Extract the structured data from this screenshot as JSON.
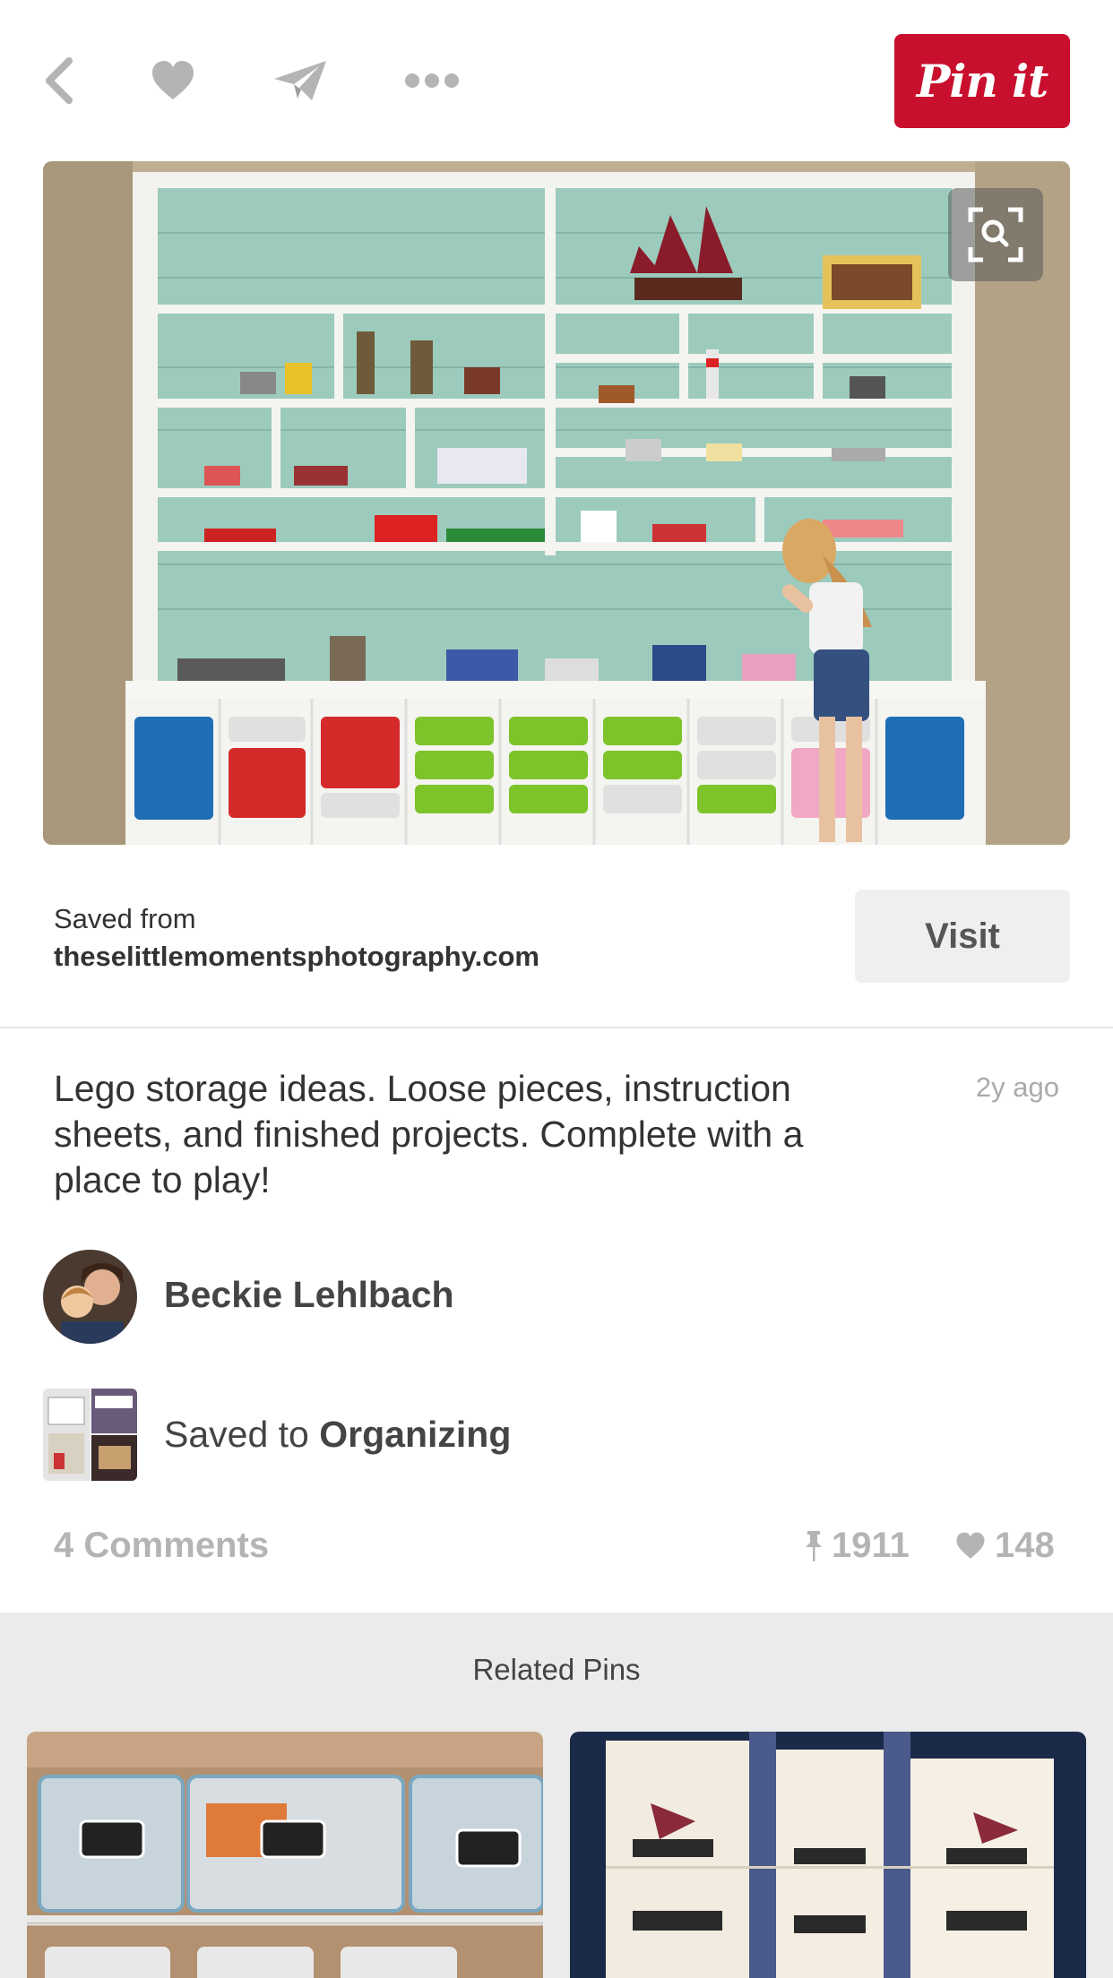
{
  "toolbar": {
    "back_icon": "chevron-left-icon",
    "like_icon": "heart-icon",
    "send_icon": "paper-plane-icon",
    "more_icon": "ellipsis-icon",
    "pin_it_label": "Pin it",
    "brand_color": "#c8102e"
  },
  "pin": {
    "image_alt": "Lego storage shelves with girl playing",
    "lens_icon": "visual-search-icon",
    "saved_from_label": "Saved from",
    "source_domain": "theselittlemomentsphotography.com",
    "visit_label": "Visit",
    "description": "Lego storage ideas. Loose pieces, instruction sheets, and finished projects. Complete with a place to play!",
    "time_ago": "2y ago",
    "author": "Beckie Lehlbach",
    "saved_to_prefix": "Saved to",
    "board_name": "Organizing",
    "comments_label": "4 Comments",
    "repin_count": "1911",
    "like_count": "148"
  },
  "related": {
    "title": "Related Pins"
  }
}
